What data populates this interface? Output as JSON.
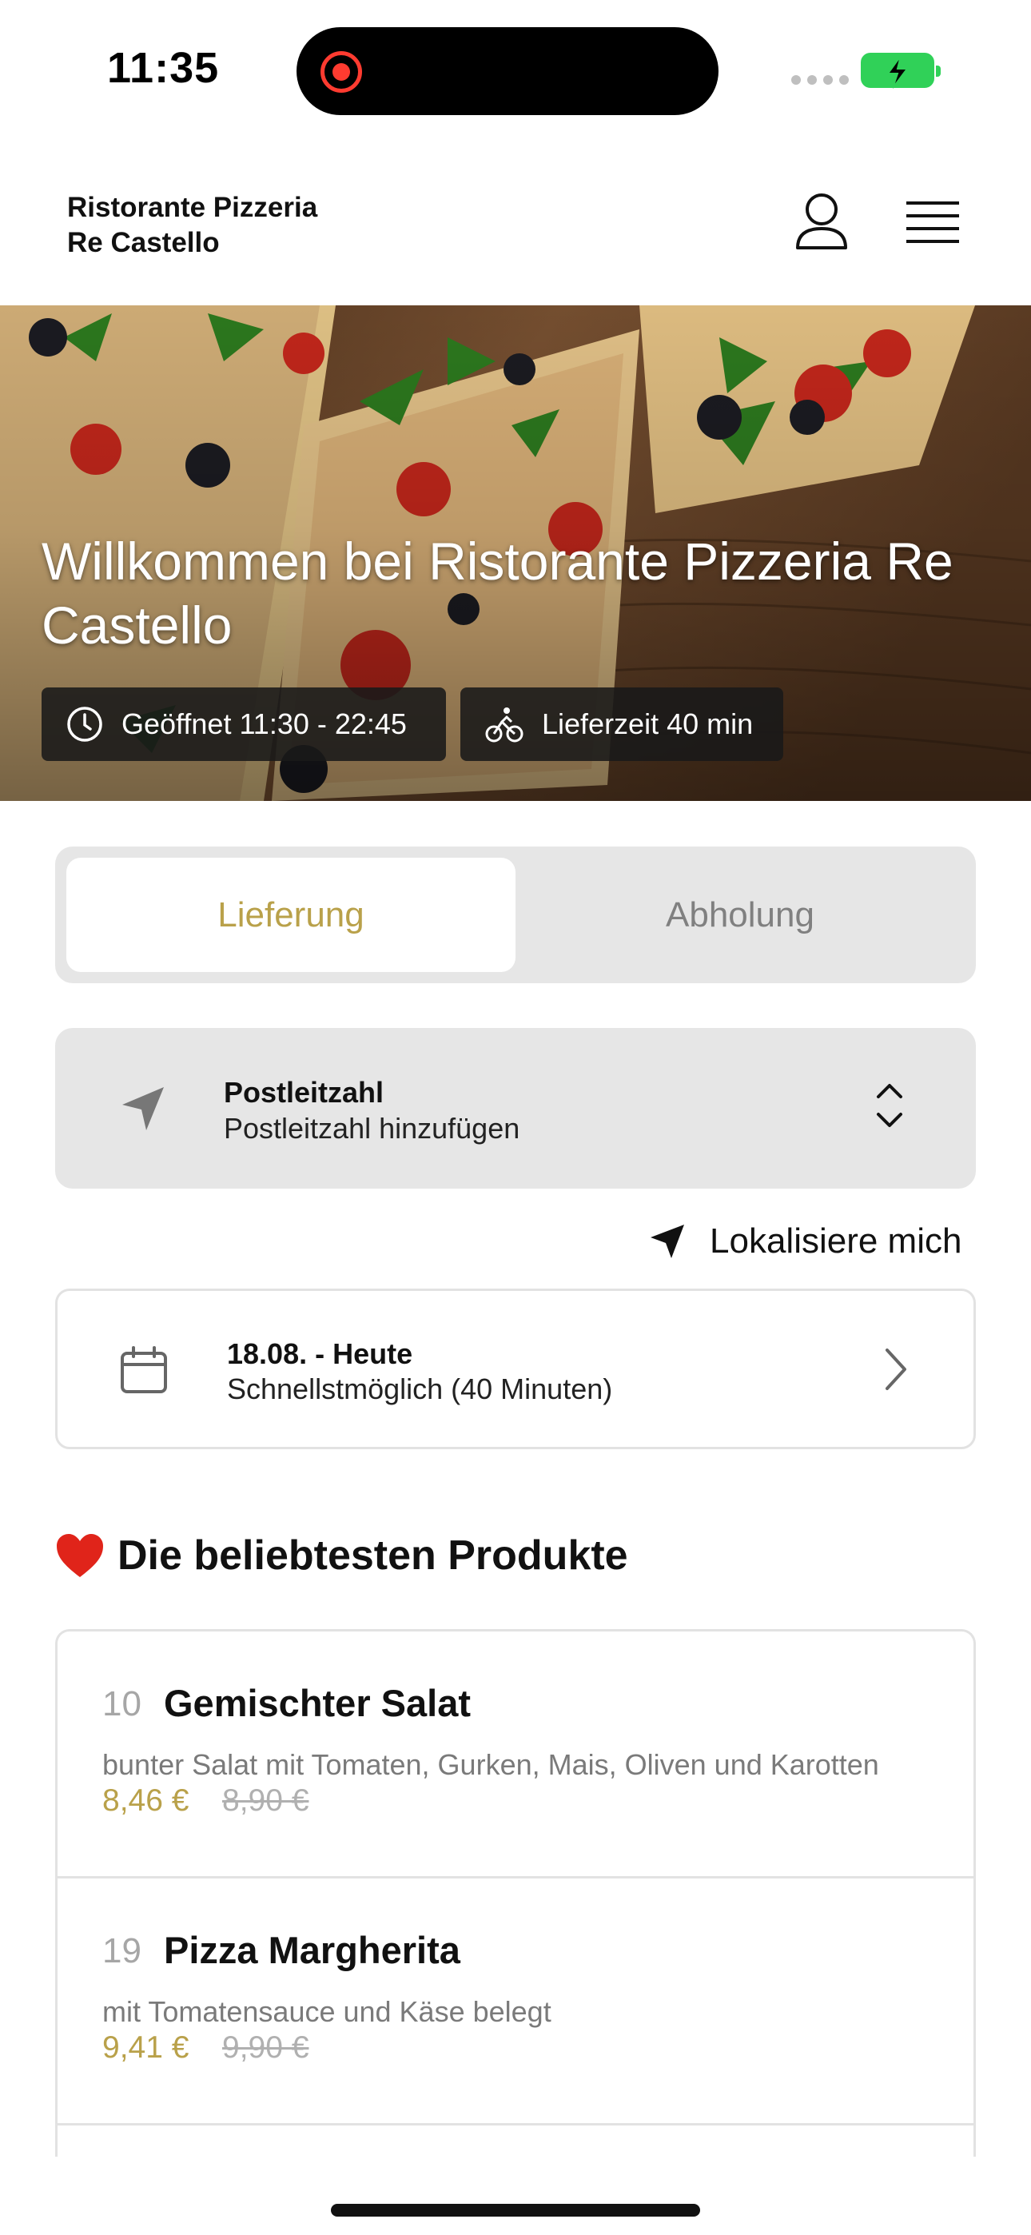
{
  "status_bar": {
    "time": "11:35"
  },
  "header": {
    "brand_line1": "Ristorante Pizzeria",
    "brand_line2": "Re Castello",
    "user_icon": "user-icon",
    "menu_icon": "hamburger-menu-icon"
  },
  "hero": {
    "title": "Willkommen bei Ristorante Pizzeria Re Castello",
    "opening_hours": "Geöffnet 11:30 - 22:45",
    "delivery_time": "Lieferzeit 40 min",
    "clock_icon": "clock-icon",
    "bike_icon": "bicycle-icon"
  },
  "order_mode": {
    "delivery_label": "Lieferung",
    "pickup_label": "Abholung",
    "selected": "Lieferung"
  },
  "postal": {
    "title": "Postleitzahl",
    "subtitle": "Postleitzahl hinzufügen"
  },
  "locate": {
    "label": "Lokalisiere mich"
  },
  "schedule": {
    "title": "18.08. - Heute",
    "subtitle": "Schnellstmöglich (40 Minuten)"
  },
  "popular": {
    "emoji": "❤️",
    "title": "Die beliebtesten Produkte",
    "items": [
      {
        "number": "10",
        "name": "Gemischter Salat",
        "description": "bunter Salat mit Tomaten, Gurken, Mais, Oliven und Karotten",
        "price": "8,46 €",
        "old_price": "8,90 €"
      },
      {
        "number": "19",
        "name": "Pizza Margherita",
        "description": "mit Tomatensauce und Käse belegt",
        "price": "9,41 €",
        "old_price": "9,90 €"
      }
    ]
  },
  "colors": {
    "accent": "#b9a14a",
    "card_grey": "#e6e6e6",
    "battery_green": "#30d158"
  }
}
